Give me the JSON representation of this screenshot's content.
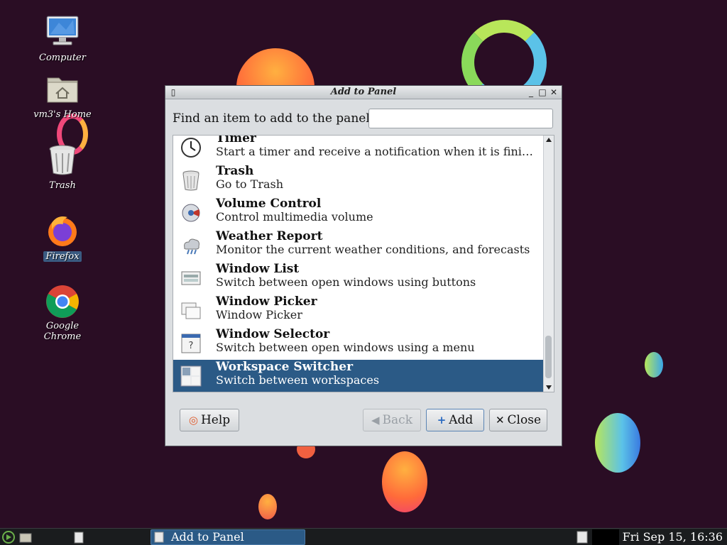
{
  "desktop": {
    "icons": [
      {
        "label": "Computer",
        "icon": "computer-icon"
      },
      {
        "label": "vm3's Home",
        "icon": "home-folder-icon"
      },
      {
        "label": "Trash",
        "icon": "trash-icon"
      },
      {
        "label": "Firefox",
        "icon": "firefox-icon"
      },
      {
        "label": "Google Chrome",
        "icon": "chrome-icon"
      }
    ]
  },
  "dialog": {
    "title": "Add to Panel",
    "find_label": "Find an item to add to the panel:",
    "find_value": "",
    "items": [
      {
        "name": "Timer",
        "desc": "Start a timer and receive a notification when it is fini…",
        "icon": "clock-icon"
      },
      {
        "name": "Trash",
        "desc": "Go to Trash",
        "icon": "trash-icon"
      },
      {
        "name": "Volume Control",
        "desc": "Control multimedia volume",
        "icon": "volume-icon"
      },
      {
        "name": "Weather Report",
        "desc": "Monitor the current weather conditions, and forecasts",
        "icon": "weather-icon"
      },
      {
        "name": "Window List",
        "desc": "Switch between open windows using buttons",
        "icon": "window-list-icon"
      },
      {
        "name": "Window Picker",
        "desc": "Window Picker",
        "icon": "window-picker-icon"
      },
      {
        "name": "Window Selector",
        "desc": "Switch between open windows using a menu",
        "icon": "window-selector-icon"
      },
      {
        "name": "Workspace Switcher",
        "desc": "Switch between workspaces",
        "icon": "workspace-switcher-icon",
        "selected": true
      }
    ],
    "buttons": {
      "help": "Help",
      "back": "Back",
      "add": "Add",
      "close": "Close"
    }
  },
  "taskbar": {
    "task_label": "Add to Panel",
    "clock": "Fri Sep 15, 16:36"
  }
}
